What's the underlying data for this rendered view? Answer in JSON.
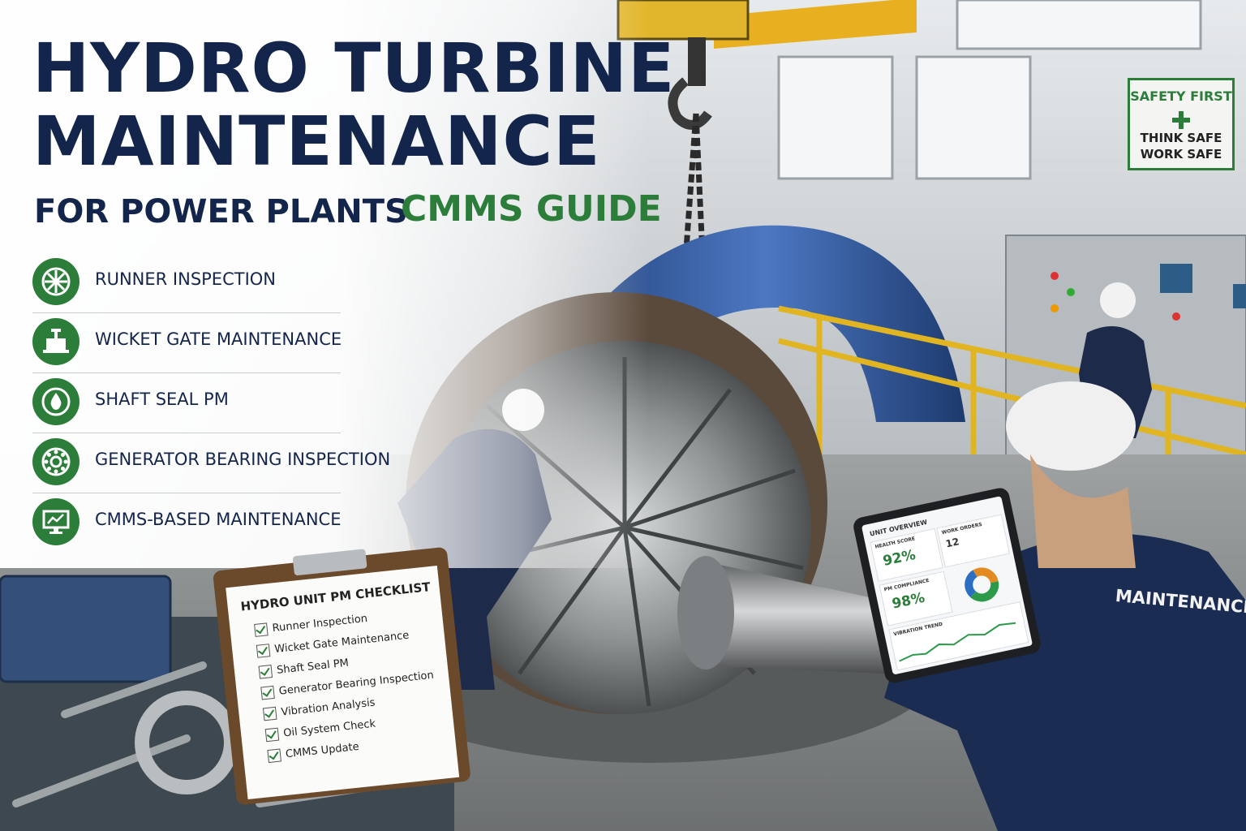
{
  "header": {
    "title_line1": "HYDRO TURBINE",
    "title_line2": "MAINTENANCE",
    "subtitle": "FOR POWER PLANTS",
    "tag": "CMMS GUIDE"
  },
  "topics": [
    {
      "label": "RUNNER INSPECTION",
      "icon": "runner-icon"
    },
    {
      "label": "WICKET GATE MAINTENANCE",
      "icon": "valve-icon"
    },
    {
      "label": "SHAFT SEAL PM",
      "icon": "oil-drop-icon"
    },
    {
      "label": "GENERATOR BEARING INSPECTION",
      "icon": "bearing-icon"
    },
    {
      "label": "CMMS-BASED MAINTENANCE",
      "icon": "monitor-chart-icon"
    }
  ],
  "safety_sign": {
    "top": "SAFETY FIRST",
    "line1": "THINK SAFE",
    "line2": "WORK SAFE"
  },
  "checklist": {
    "title": "HYDRO UNIT PM CHECKLIST",
    "items": [
      "Runner Inspection",
      "Wicket Gate Maintenance",
      "Shaft Seal PM",
      "Generator Bearing Inspection",
      "Vibration Analysis",
      "Oil System Check",
      "CMMS Update"
    ]
  },
  "tablet": {
    "heading": "UNIT OVERVIEW",
    "health_label": "HEALTH SCORE",
    "health_value": "92%",
    "work_orders_label": "WORK ORDERS",
    "work_orders_value": "12",
    "pm_label": "PM COMPLIANCE",
    "pm_value": "98%",
    "trend_label": "VIBRATION TREND"
  },
  "vest_text": "MAINTENANCE",
  "colors": {
    "navy": "#13254a",
    "green": "#2c7d3a",
    "pipe_blue": "#3d63a8",
    "crane_yellow": "#e8b020"
  }
}
